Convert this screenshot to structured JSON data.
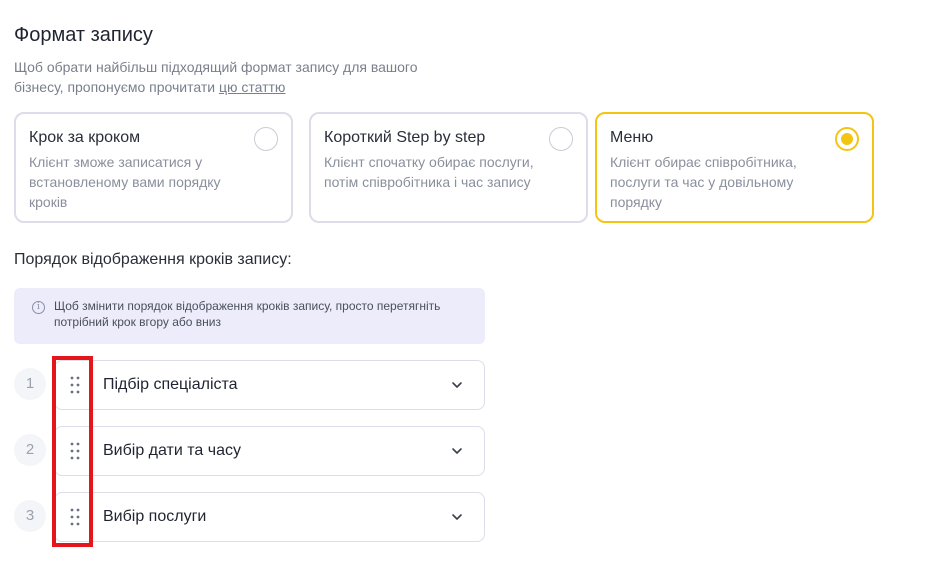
{
  "format": {
    "title": "Формат запису",
    "subtitle_text": "Щоб обрати найбільш підходящий формат запису для вашого бізнесу, пропонуємо прочитати ",
    "subtitle_link": "цю статтю",
    "options": [
      {
        "title": "Крок за кроком",
        "desc": "Клієнт зможе записатися у встановленому вами порядку кроків",
        "selected": false
      },
      {
        "title": "Короткий Step by step",
        "desc": "Клієнт спочатку обирає послуги, потім співробітника і час запису",
        "selected": false
      },
      {
        "title": "Меню",
        "desc": "Клієнт обирає співробітника, послуги та час у довільному порядку",
        "selected": true
      }
    ],
    "accent_color": "#f3c512"
  },
  "steps": {
    "label": "Порядок відображення кроків запису:",
    "info": "Щоб змінити порядок відображення кроків запису, просто перетягніть потрібний крок вгору або вниз",
    "info_icon": "info-icon",
    "items": [
      {
        "num": "1",
        "label": "Підбір спеціаліста"
      },
      {
        "num": "2",
        "label": "Вибір дати та часу"
      },
      {
        "num": "3",
        "label": "Вибір послуги"
      }
    ],
    "highlight_color": "#e3161b"
  }
}
